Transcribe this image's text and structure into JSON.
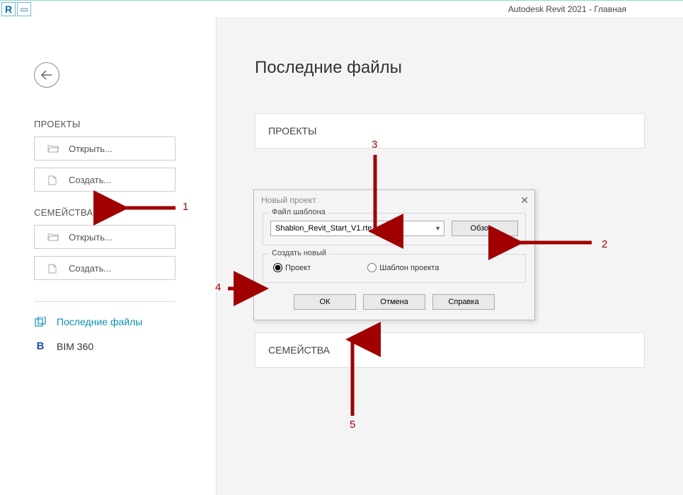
{
  "titlebar": {
    "app_title": "Autodesk Revit 2021 - Главная"
  },
  "sidebar": {
    "projects_title": "ПРОЕКТЫ",
    "families_title": "СЕМЕЙСТВА",
    "open_label": "Открыть...",
    "create_label": "Создать...",
    "nav_recent": "Последние файлы",
    "nav_bim360": "BIM 360"
  },
  "main": {
    "page_title": "Последние файлы",
    "card_projects": "ПРОЕКТЫ",
    "card_families": "СЕМЕЙСТВА"
  },
  "dialog": {
    "title": "Новый проект",
    "template_legend": "Файл шаблона",
    "template_value": "Shablon_Revit_Start_V1.rte",
    "browse_label": "Обзор...",
    "create_new_legend": "Создать новый",
    "radio_project": "Проект",
    "radio_template": "Шаблон проекта",
    "ok": "ОК",
    "cancel": "Отмена",
    "help": "Справка"
  },
  "annotations": {
    "n1": "1",
    "n2": "2",
    "n3": "3",
    "n4": "4",
    "n5": "5"
  }
}
